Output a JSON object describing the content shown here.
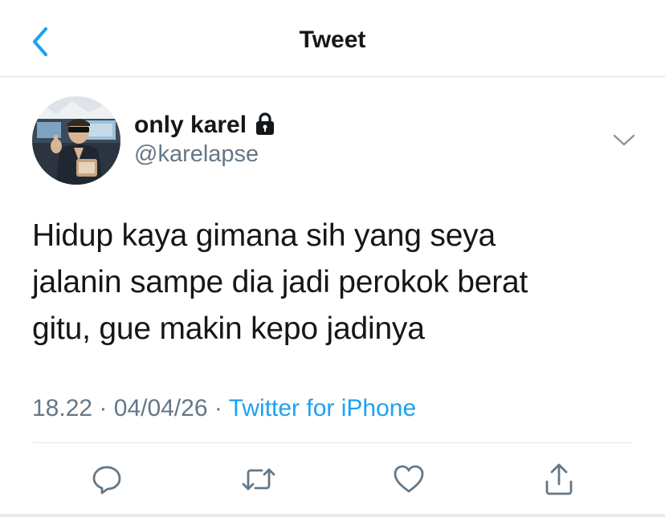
{
  "nav": {
    "title": "Tweet",
    "back_icon": "chevron-left-icon"
  },
  "author": {
    "display_name": "only karel",
    "handle": "@karelapse",
    "protected_icon": "lock-icon"
  },
  "tweet": {
    "lines": [
      "Hidup kaya gimana sih yang seya",
      "jalanin sampe dia jadi perokok berat",
      "gitu, gue makin kepo jadinya"
    ],
    "time": "18.22",
    "separator": "·",
    "date": "04/04/26",
    "source": "Twitter for iPhone"
  },
  "actions": [
    "reply-icon",
    "retweet-icon",
    "like-icon",
    "share-icon"
  ],
  "colors": {
    "accent": "#1da1f2",
    "secondary_text": "#657786",
    "primary_text": "#14171a"
  }
}
